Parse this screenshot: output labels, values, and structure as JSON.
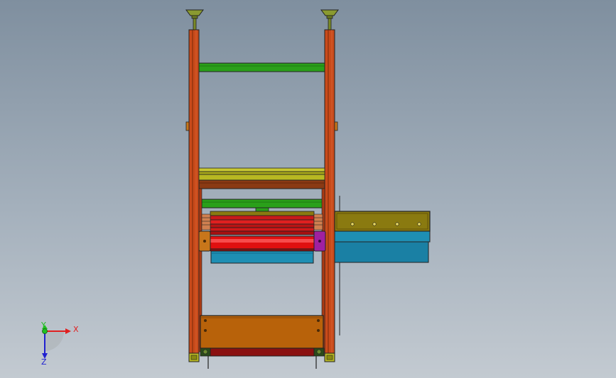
{
  "axes": {
    "x_label": "X",
    "y_label": "Y",
    "z_label": "Z"
  },
  "colors": {
    "frame": "#c84a1a",
    "beam_green": "#2aa01a",
    "beam_yellow": "#b8b822",
    "beam_olive": "#8a7a10",
    "roller_red": "#e01010",
    "panel_blue": "#1e8fb4",
    "plate_orange": "#b8620a",
    "bracket_purple": "#a020a0",
    "dark_red": "#8a1010",
    "foot_olive": "#8a9a30",
    "axis_x": "#e02020",
    "axis_y": "#20c020",
    "axis_z": "#2020d0"
  },
  "icons": {
    "triad": "axis-triad-icon"
  }
}
